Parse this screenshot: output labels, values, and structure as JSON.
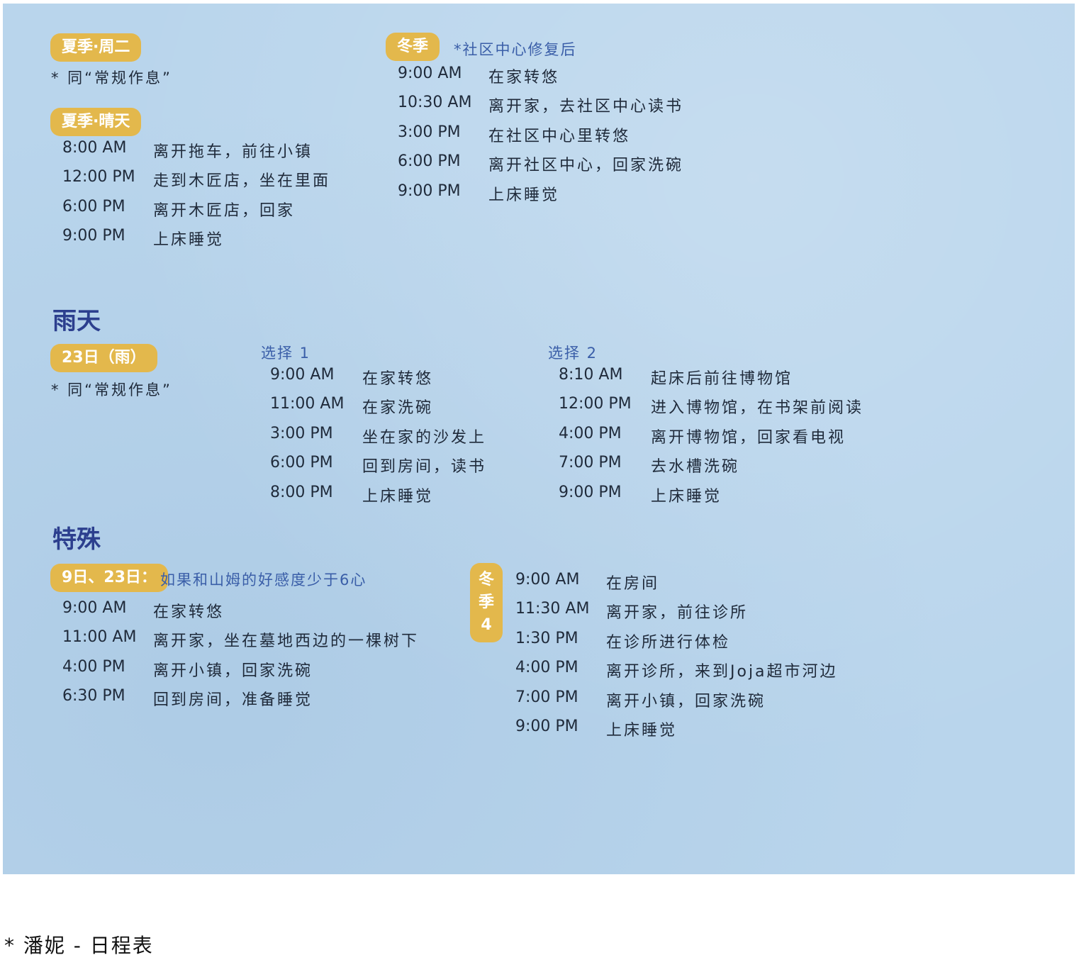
{
  "summer_tue": {
    "tag": "夏季·周二",
    "note": "* 同“常规作息”"
  },
  "summer_sunny": {
    "tag": "夏季·晴天",
    "rows": [
      {
        "time": "8:00 AM",
        "action": "离开拖车，前往小镇"
      },
      {
        "time": "12:00 PM",
        "action": "走到木匠店，坐在里面"
      },
      {
        "time": "6:00 PM",
        "action": "离开木匠店，回家"
      },
      {
        "time": "9:00 PM",
        "action": "上床睡觉"
      }
    ]
  },
  "winter": {
    "tag": "冬季",
    "note": "*社区中心修复后",
    "rows": [
      {
        "time": "9:00 AM",
        "action": "在家转悠"
      },
      {
        "time": "10:30 AM",
        "action": "离开家，去社区中心读书"
      },
      {
        "time": "3:00 PM",
        "action": "在社区中心里转悠"
      },
      {
        "time": "6:00 PM",
        "action": "离开社区中心，回家洗碗"
      },
      {
        "time": "9:00 PM",
        "action": "上床睡觉"
      }
    ]
  },
  "rain": {
    "heading": "雨天",
    "tag": "23日（雨）",
    "note": "* 同“常规作息”",
    "option1": {
      "label": "选择 1",
      "rows": [
        {
          "time": "9:00 AM",
          "action": "在家转悠"
        },
        {
          "time": "11:00 AM",
          "action": "在家洗碗"
        },
        {
          "time": "3:00 PM",
          "action": "坐在家的沙发上"
        },
        {
          "time": "6:00 PM",
          "action": "回到房间，读书"
        },
        {
          "time": "8:00 PM",
          "action": "上床睡觉"
        }
      ]
    },
    "option2": {
      "label": "选择 2",
      "rows": [
        {
          "time": "8:10 AM",
          "action": "起床后前往博物馆"
        },
        {
          "time": "12:00 PM",
          "action": "进入博物馆，在书架前阅读"
        },
        {
          "time": "4:00 PM",
          "action": "离开博物馆，回家看电视"
        },
        {
          "time": "7:00 PM",
          "action": "去水槽洗碗"
        },
        {
          "time": "9:00 PM",
          "action": "上床睡觉"
        }
      ]
    }
  },
  "special": {
    "heading": "特殊",
    "tag": "9日、23日：",
    "note": "如果和山姆的好感度少于6心",
    "rows": [
      {
        "time": "9:00 AM",
        "action": "在家转悠"
      },
      {
        "time": "11:00 AM",
        "action": "离开家，坐在墓地西边的一棵树下"
      },
      {
        "time": "4:00 PM",
        "action": "离开小镇，回家洗碗"
      },
      {
        "time": "6:30 PM",
        "action": "回到房间，准备睡觉"
      }
    ],
    "winter4": {
      "tag_chars": [
        "冬",
        "季",
        "4"
      ],
      "rows": [
        {
          "time": "9:00 AM",
          "action": "在房间"
        },
        {
          "time": "11:30 AM",
          "action": "离开家，前往诊所"
        },
        {
          "time": "1:30 PM",
          "action": "在诊所进行体检"
        },
        {
          "time": "4:00 PM",
          "action": "离开诊所，来到Joja超市河边"
        },
        {
          "time": "7:00 PM",
          "action": "离开小镇，回家洗碗"
        },
        {
          "time": "9:00 PM",
          "action": "上床睡觉"
        }
      ]
    }
  },
  "footer": "* 潘妮 - 日程表",
  "colors": {
    "paper": "#b9d5ec",
    "tag": "#e3b84c",
    "heading": "#2c3f8e",
    "note_blue": "#3a5ea8"
  }
}
